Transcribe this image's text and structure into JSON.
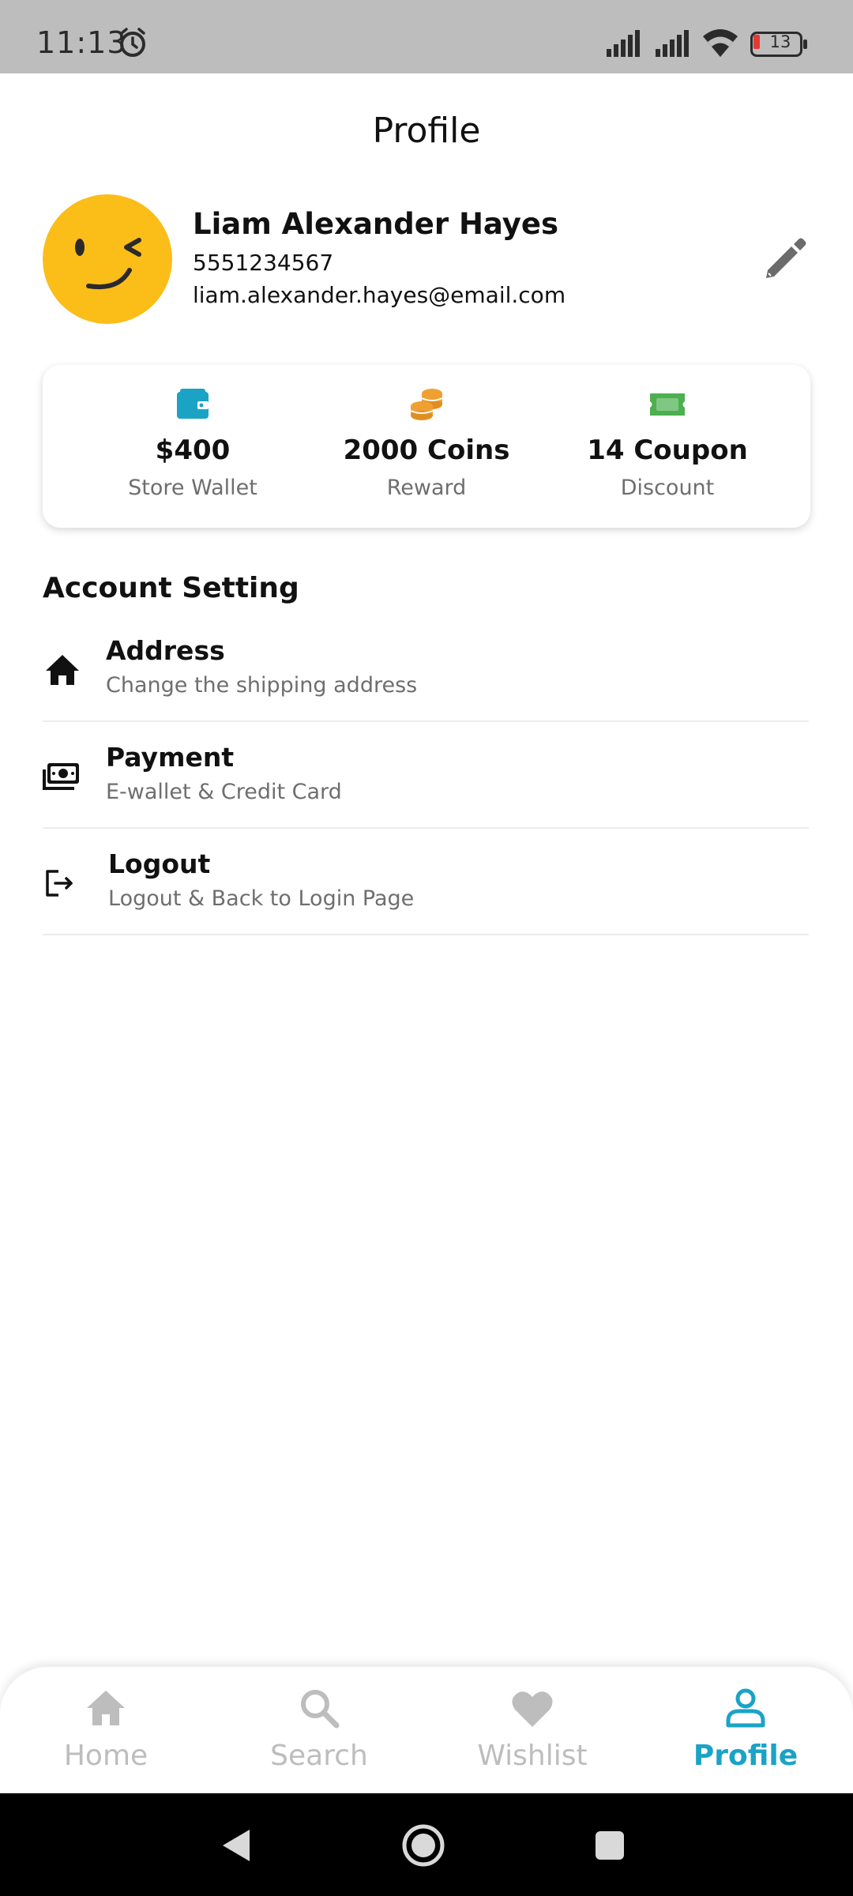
{
  "status_bar": {
    "time": "11:13",
    "battery_level": "13",
    "icons": [
      "alarm-icon",
      "signal-icon",
      "signal-icon",
      "wifi-icon",
      "battery-icon"
    ]
  },
  "header": {
    "title": "Profile"
  },
  "profile": {
    "name": "Liam Alexander Hayes",
    "phone": "5551234567",
    "email": "liam.alexander.hayes@email.com",
    "avatar_icon": "winking-face-icon",
    "edit_icon": "pencil-icon"
  },
  "stats": [
    {
      "icon": "wallet-icon",
      "value": "$400",
      "label": "Store Wallet",
      "color": "#1ba3c6"
    },
    {
      "icon": "coins-icon",
      "value": "2000 Coins",
      "label": "Reward",
      "color": "#f0a033"
    },
    {
      "icon": "ticket-icon",
      "value": "14 Coupon",
      "label": "Discount",
      "color": "#4caf50"
    }
  ],
  "account_setting": {
    "title": "Account Setting",
    "items": [
      {
        "icon": "home-icon",
        "title": "Address",
        "subtitle": "Change the shipping address"
      },
      {
        "icon": "money-icon",
        "title": "Payment",
        "subtitle": "E-wallet & Credit Card"
      },
      {
        "icon": "logout-icon",
        "title": "Logout",
        "subtitle": "Logout & Back to Login Page"
      }
    ]
  },
  "bottom_nav": {
    "active": "Profile",
    "active_color": "#1ba3c6",
    "inactive_color": "#bdbdbd",
    "items": [
      {
        "icon": "home-icon",
        "label": "Home"
      },
      {
        "icon": "search-icon",
        "label": "Search"
      },
      {
        "icon": "heart-icon",
        "label": "Wishlist"
      },
      {
        "icon": "person-icon",
        "label": "Profile"
      }
    ]
  },
  "system_nav": {
    "icons": [
      "back-icon",
      "home-circle-icon",
      "recents-icon"
    ]
  }
}
